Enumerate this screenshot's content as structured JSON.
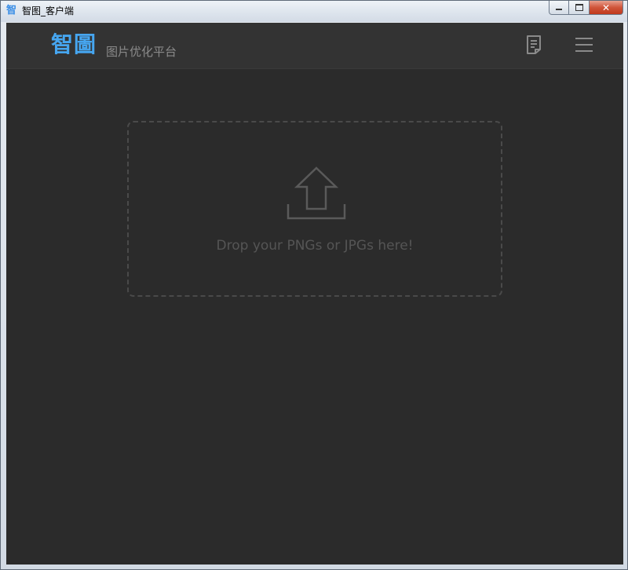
{
  "window": {
    "icon_glyph": "智",
    "title": "智图_客户端",
    "controls": {
      "minimize": "minimize",
      "maximize": "maximize",
      "close_glyph": "✕"
    }
  },
  "header": {
    "logo": "智圖",
    "slogan": "图片优化平台",
    "buttons": [
      {
        "name": "document-icon"
      },
      {
        "name": "hamburger-menu-icon"
      }
    ]
  },
  "dropzone": {
    "icon": "upload-arrow-icon",
    "text": "Drop your PNGs or JPGs here!"
  },
  "colors": {
    "accent": "#46a6f0",
    "background": "#2b2b2b",
    "header_bg": "#333333",
    "muted_text": "#555555",
    "slogan_text": "#8a8a8a"
  }
}
